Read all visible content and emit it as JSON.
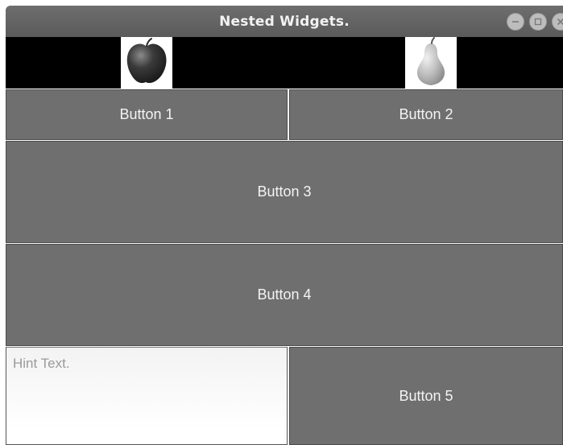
{
  "window": {
    "title": "Nested Widgets.",
    "controls": [
      {
        "icon": "minimize-icon"
      },
      {
        "icon": "maximize-icon"
      },
      {
        "icon": "close-icon"
      }
    ]
  },
  "images": [
    {
      "icon": "apple-icon"
    },
    {
      "icon": "pear-icon"
    }
  ],
  "buttons": {
    "b1": "Button 1",
    "b2": "Button 2",
    "b3": "Button 3",
    "b4": "Button 4",
    "b5": "Button 5"
  },
  "text_input": {
    "placeholder": "Hint Text.",
    "value": ""
  },
  "colors": {
    "button_bg": "#6f6f6f",
    "image_strip_bg": "#000000",
    "titlebar_bg": "#5a5a5a"
  }
}
